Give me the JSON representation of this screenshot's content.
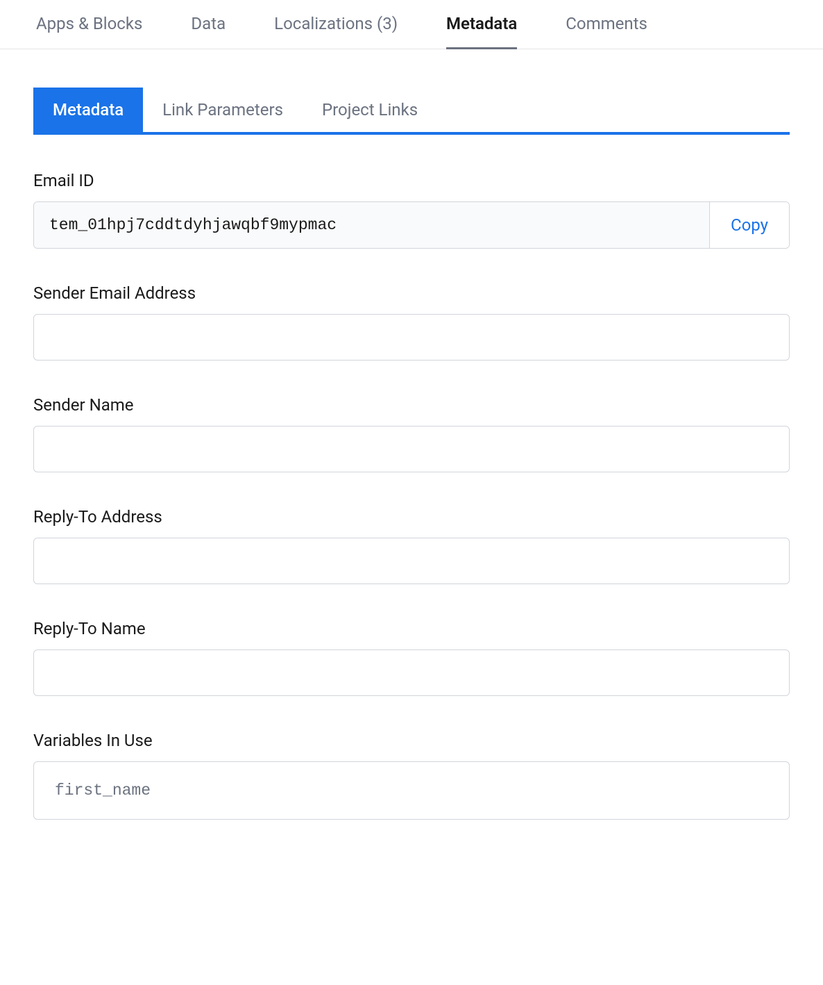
{
  "top_tabs": {
    "apps_blocks": "Apps & Blocks",
    "data": "Data",
    "localizations_label": "Localizations",
    "localizations_count": "(3)",
    "metadata": "Metadata",
    "comments": "Comments"
  },
  "sub_tabs": {
    "metadata": "Metadata",
    "link_parameters": "Link Parameters",
    "project_links": "Project Links"
  },
  "fields": {
    "email_id": {
      "label": "Email ID",
      "value": "tem_01hpj7cddtdyhjawqbf9mypmac",
      "copy_label": "Copy"
    },
    "sender_email": {
      "label": "Sender Email Address",
      "value": ""
    },
    "sender_name": {
      "label": "Sender Name",
      "value": ""
    },
    "reply_to_address": {
      "label": "Reply-To Address",
      "value": ""
    },
    "reply_to_name": {
      "label": "Reply-To Name",
      "value": ""
    },
    "variables": {
      "label": "Variables In Use",
      "value": "first_name"
    }
  }
}
